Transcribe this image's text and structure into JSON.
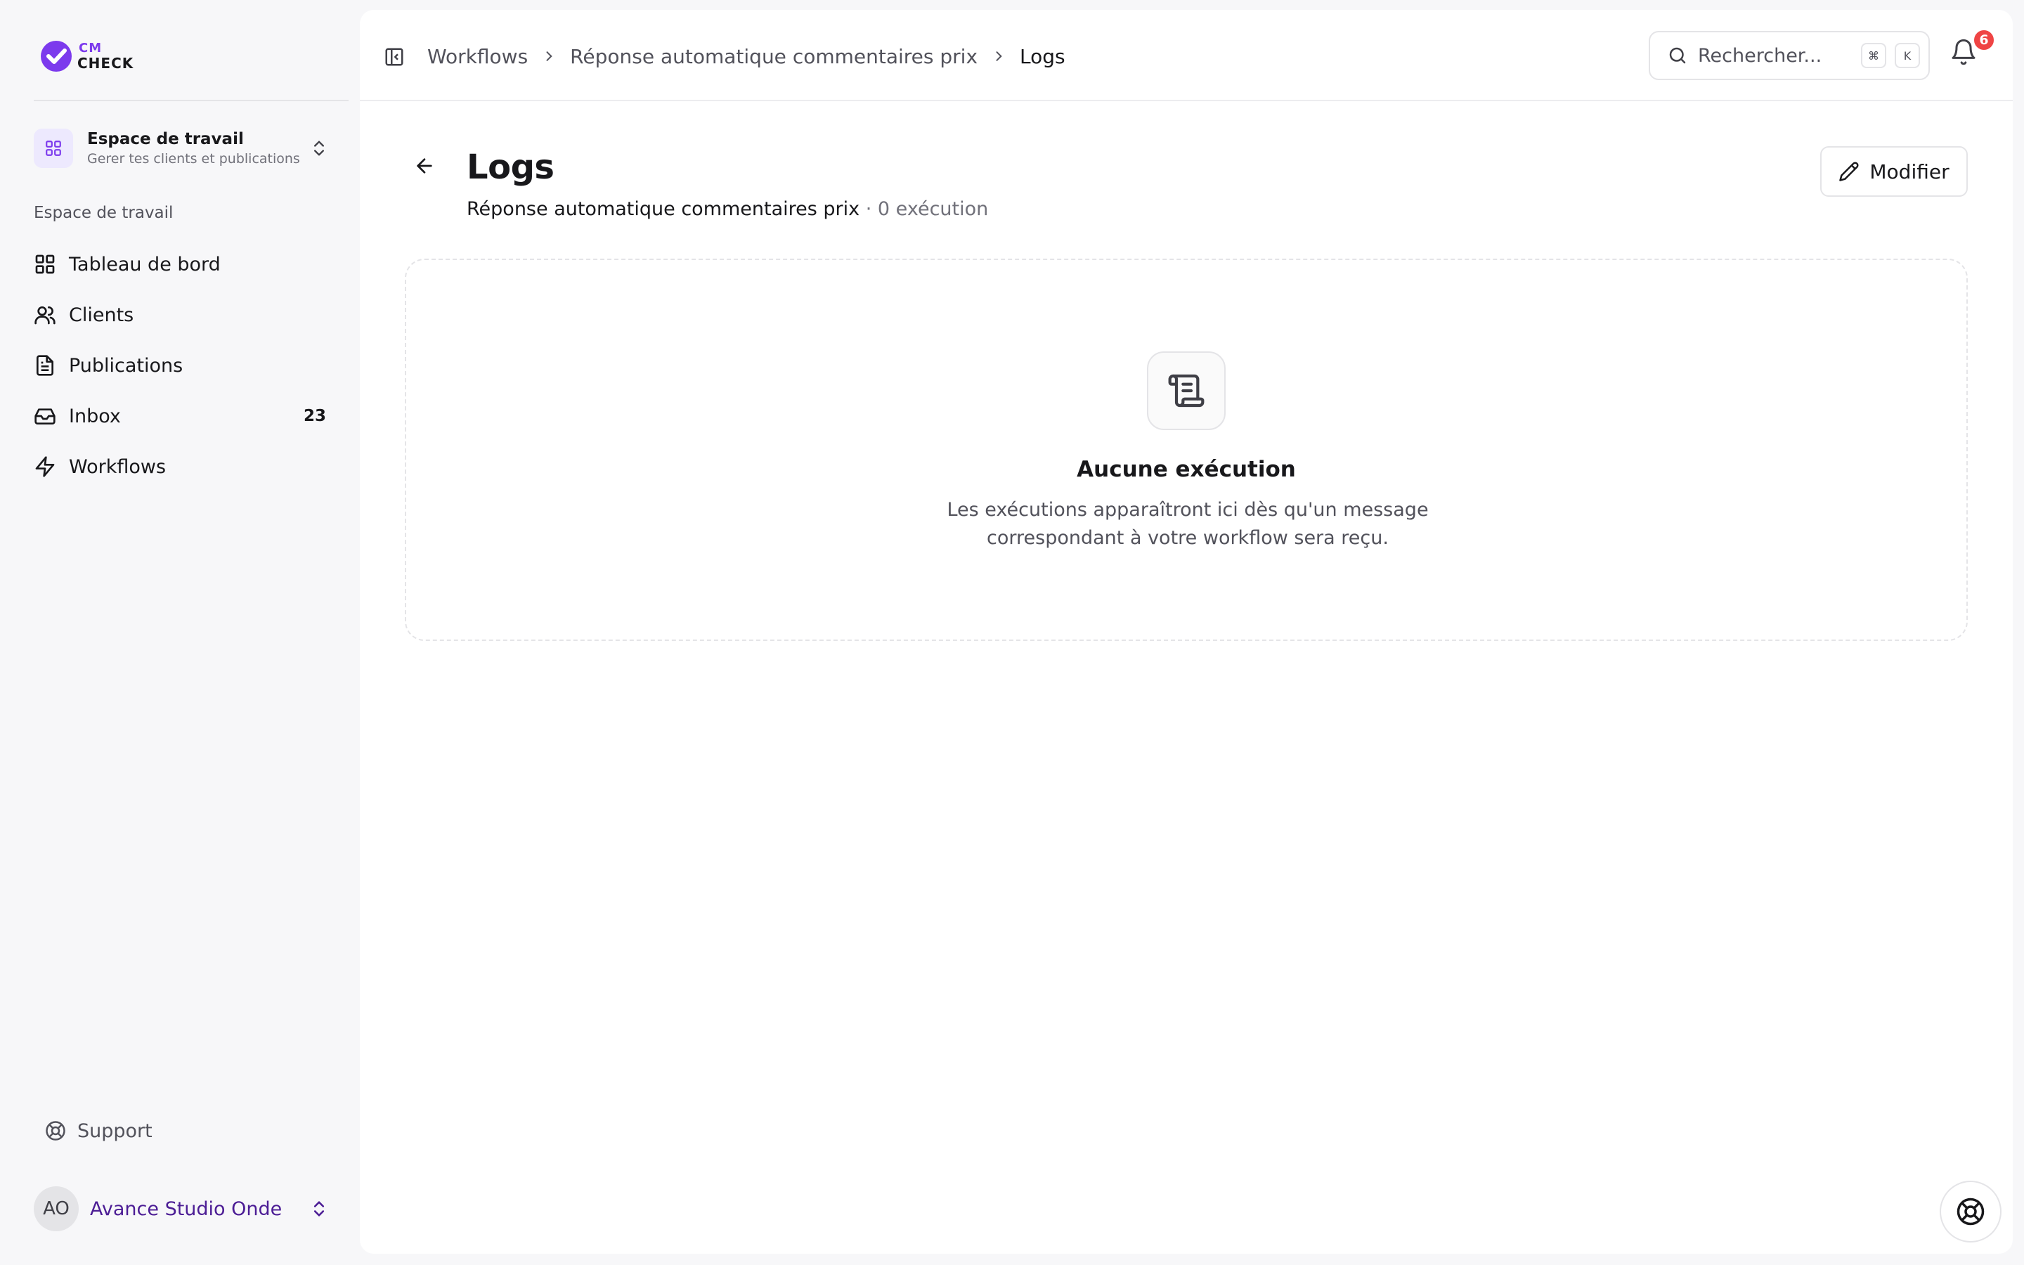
{
  "logo": {
    "line1": "CM",
    "line2": "CHECK"
  },
  "workspace": {
    "name": "Espace de travail",
    "subtitle": "Gerer tes clients et publications",
    "icon": "grid-icon"
  },
  "sidebar": {
    "section_label": "Espace de travail",
    "items": [
      {
        "label": "Tableau de bord",
        "icon": "dashboard-icon",
        "badge": ""
      },
      {
        "label": "Clients",
        "icon": "users-icon",
        "badge": ""
      },
      {
        "label": "Publications",
        "icon": "file-text-icon",
        "badge": ""
      },
      {
        "label": "Inbox",
        "icon": "inbox-icon",
        "badge": "23"
      },
      {
        "label": "Workflows",
        "icon": "zap-icon",
        "badge": ""
      }
    ],
    "support_label": "Support"
  },
  "user": {
    "initials": "AO",
    "name": "Avance Studio Onde"
  },
  "breadcrumb": [
    "Workflows",
    "Réponse automatique commentaires prix",
    "Logs"
  ],
  "search": {
    "placeholder": "Rechercher...",
    "shortcut_mod": "⌘",
    "shortcut_key": "K"
  },
  "notifications": {
    "count": "6"
  },
  "page": {
    "title": "Logs",
    "workflow_name": "Réponse automatique commentaires prix",
    "execution_count": "· 0 exécution",
    "edit_label": "Modifier"
  },
  "empty_state": {
    "title": "Aucune exécution",
    "description": "Les exécutions apparaîtront ici dès qu'un message correspondant à votre workflow sera reçu."
  },
  "colors": {
    "accent": "#7c3aed",
    "badge_red": "#ef4444",
    "user_name": "#4c1d95"
  }
}
